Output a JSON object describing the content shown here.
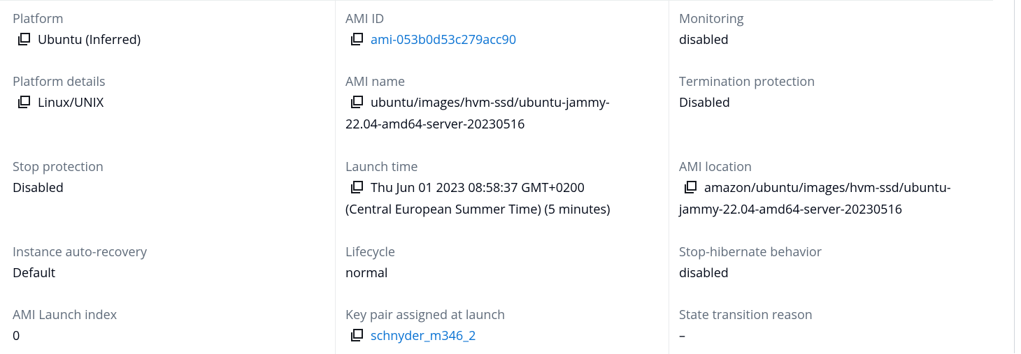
{
  "columns": [
    {
      "fields": [
        {
          "label": "Platform",
          "value": "Ubuntu (Inferred)"
        },
        {
          "label": "Platform details",
          "value": "Linux/UNIX"
        },
        {
          "label": "Stop protection",
          "value": "Disabled"
        },
        {
          "label": "Instance auto-recovery",
          "value": "Default"
        },
        {
          "label": "AMI Launch index",
          "value": "0"
        }
      ]
    },
    {
      "fields": [
        {
          "label": "AMI ID",
          "value": "ami-053b0d53c279acc90"
        },
        {
          "label": "AMI name",
          "value_line1": "ubuntu/images/hvm-ssd/ubuntu-jammy-",
          "value_line2": "22.04-amd64-server-20230516"
        },
        {
          "label": "Launch time",
          "value_line1": "Thu Jun 01 2023 08:58:37 GMT+0200",
          "value_line2": "(Central European Summer Time) (5 minutes)"
        },
        {
          "label": "Lifecycle",
          "value": "normal"
        },
        {
          "label": "Key pair assigned at launch",
          "value": "schnyder_m346_2"
        }
      ]
    },
    {
      "fields": [
        {
          "label": "Monitoring",
          "value": "disabled"
        },
        {
          "label": "Termination protection",
          "value": "Disabled"
        },
        {
          "label": "AMI location",
          "value_line1": "amazon/ubuntu/images/hvm-ssd/ubuntu-",
          "value_line2": "jammy-22.04-amd64-server-20230516"
        },
        {
          "label": "Stop-hibernate behavior",
          "value": "disabled"
        },
        {
          "label": "State transition reason",
          "value": "–"
        }
      ]
    }
  ],
  "colors": {
    "label": "#5f6b7a",
    "value": "#000716",
    "link": "#0972d3",
    "divider": "#e9ebed"
  }
}
